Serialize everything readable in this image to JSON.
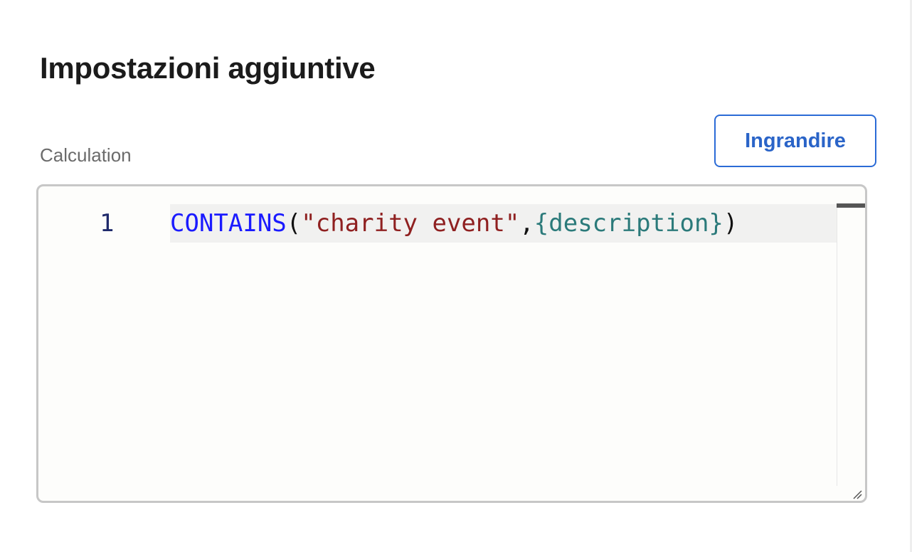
{
  "section": {
    "title": "Impostazioni aggiuntive"
  },
  "field": {
    "label": "Calculation",
    "expand_button_label": "Ingrandire"
  },
  "editor": {
    "line_number": "1",
    "tokens": {
      "function": "CONTAINS",
      "open_paren": "(",
      "string": "\"charity event\"",
      "comma": ",",
      "field_ref": "{description}",
      "close_paren": ")"
    },
    "resize_icon": "resize-grip-icon"
  },
  "colors": {
    "accent": "#2b6bd6",
    "function_token": "#1a1aff",
    "string_token": "#8f2020",
    "field_token": "#2b7a7a",
    "line_number": "#1f2a6b"
  }
}
